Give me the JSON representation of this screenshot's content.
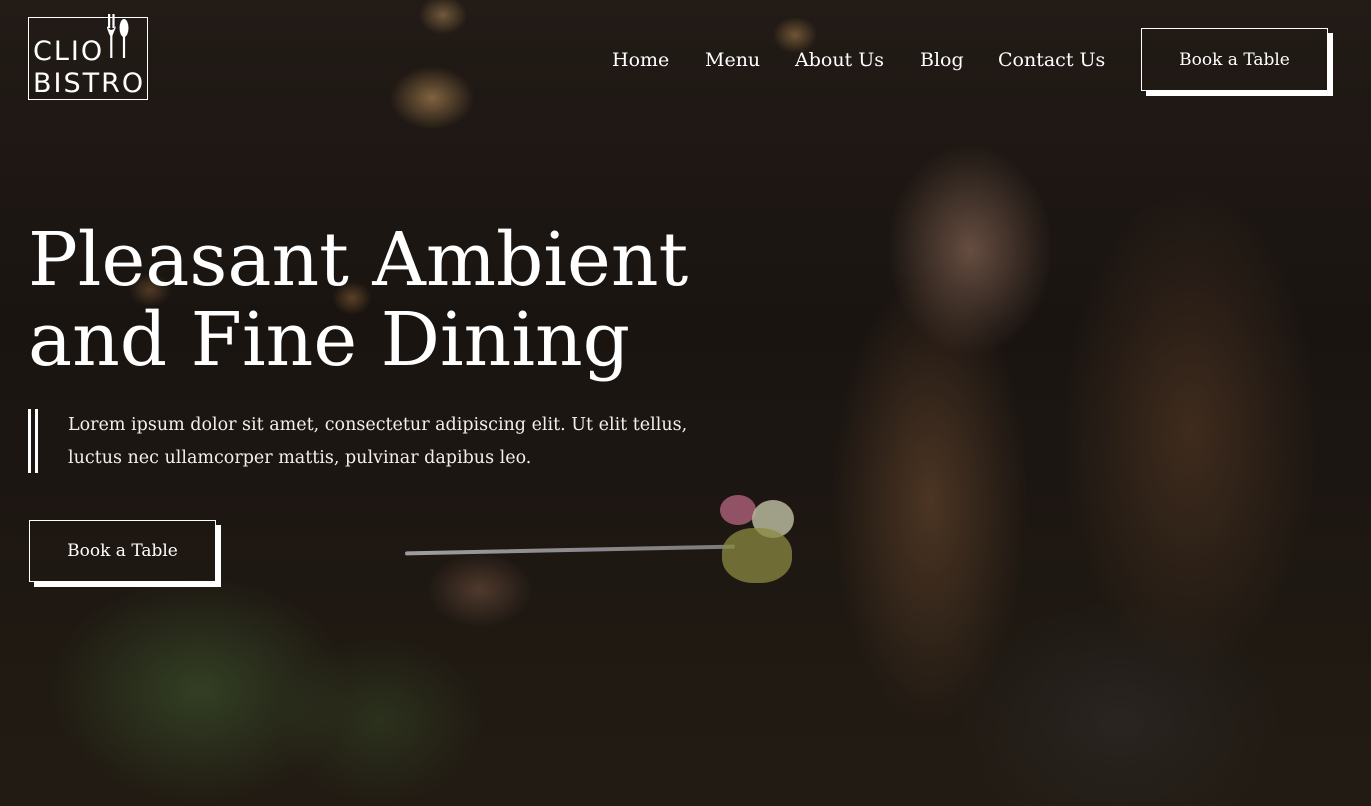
{
  "brand": {
    "logo_line_1": "CLIO",
    "logo_line_2": "BISTRO",
    "icon": "cutlery-icon"
  },
  "nav": {
    "items": [
      {
        "label": "Home"
      },
      {
        "label": "Menu"
      },
      {
        "label": "About Us"
      },
      {
        "label": "Blog"
      },
      {
        "label": "Contact Us"
      }
    ],
    "cta_label": "Book a Table"
  },
  "hero": {
    "title_line_1": "Pleasant Ambient",
    "title_line_2": "and Fine Dining",
    "text_line_1": "Lorem ipsum dolor sit amet, consectetur adipiscing elit. Ut elit tellus,",
    "text_line_2": "luctus nec ullamcorper mattis, pulvinar dapibus leo.",
    "cta_label": "Book a Table"
  },
  "colors": {
    "text": "#ffffff",
    "overlay": "#1a1411"
  }
}
